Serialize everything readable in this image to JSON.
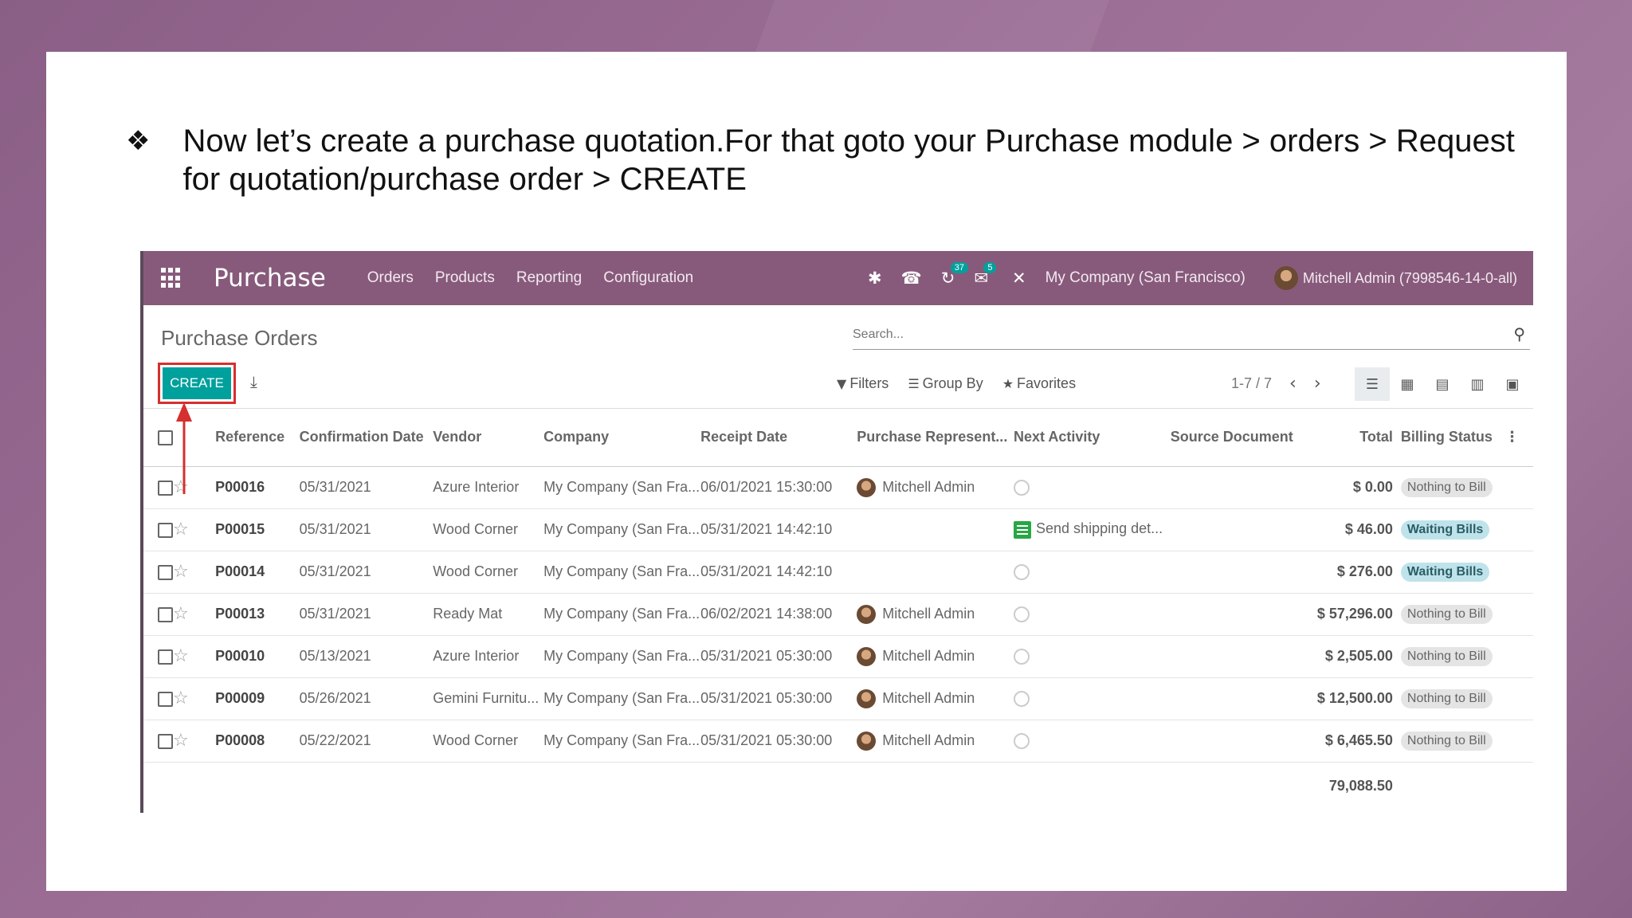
{
  "slide": {
    "bullet_glyph": "❖",
    "instruction": "Now let’s create a purchase quotation.For that goto your Purchase module > orders > Request for quotation/purchase order  > CREATE"
  },
  "navbar": {
    "app_name": "Purchase",
    "menu": [
      "Orders",
      "Products",
      "Reporting",
      "Configuration"
    ],
    "badge_activities": "37",
    "badge_messages": "5",
    "company": "My Company (San Francisco)",
    "user": "Mitchell Admin (7998546-14-0-all)"
  },
  "control_panel": {
    "breadcrumb": "Purchase Orders",
    "search_placeholder": "Search...",
    "create_label": "CREATE",
    "filters_label": "Filters",
    "group_by_label": "Group By",
    "favorites_label": "Favorites",
    "pager": "1-7 / 7"
  },
  "table": {
    "columns": [
      "Reference",
      "Confirmation Date",
      "Vendor",
      "Company",
      "Receipt Date",
      "Purchase Represent...",
      "Next Activity",
      "Source Document",
      "Total",
      "Billing Status"
    ],
    "rows": [
      {
        "ref": "P00016",
        "conf": "05/31/2021",
        "vendor": "Azure Interior",
        "company": "My Company (San Fra...",
        "receipt": "06/01/2021 15:30:00",
        "rep": "Mitchell Admin",
        "activity": "",
        "source": "",
        "total": "$ 0.00",
        "status": "Nothing to Bill"
      },
      {
        "ref": "P00015",
        "conf": "05/31/2021",
        "vendor": "Wood Corner",
        "company": "My Company (San Fra...",
        "receipt": "05/31/2021 14:42:10",
        "rep": "",
        "activity": "Send shipping det...",
        "source": "",
        "total": "$ 46.00",
        "status": "Waiting Bills"
      },
      {
        "ref": "P00014",
        "conf": "05/31/2021",
        "vendor": "Wood Corner",
        "company": "My Company (San Fra...",
        "receipt": "05/31/2021 14:42:10",
        "rep": "",
        "activity": "",
        "source": "",
        "total": "$ 276.00",
        "status": "Waiting Bills"
      },
      {
        "ref": "P00013",
        "conf": "05/31/2021",
        "vendor": "Ready Mat",
        "company": "My Company (San Fra...",
        "receipt": "06/02/2021 14:38:00",
        "rep": "Mitchell Admin",
        "activity": "",
        "source": "",
        "total": "$ 57,296.00",
        "status": "Nothing to Bill"
      },
      {
        "ref": "P00010",
        "conf": "05/13/2021",
        "vendor": "Azure Interior",
        "company": "My Company (San Fra...",
        "receipt": "05/31/2021 05:30:00",
        "rep": "Mitchell Admin",
        "activity": "",
        "source": "",
        "total": "$ 2,505.00",
        "status": "Nothing to Bill"
      },
      {
        "ref": "P00009",
        "conf": "05/26/2021",
        "vendor": "Gemini Furnitu...",
        "company": "My Company (San Fra...",
        "receipt": "05/31/2021 05:30:00",
        "rep": "Mitchell Admin",
        "activity": "",
        "source": "",
        "total": "$ 12,500.00",
        "status": "Nothing to Bill"
      },
      {
        "ref": "P00008",
        "conf": "05/22/2021",
        "vendor": "Wood Corner",
        "company": "My Company (San Fra...",
        "receipt": "05/31/2021 05:30:00",
        "rep": "Mitchell Admin",
        "activity": "",
        "source": "",
        "total": "$ 6,465.50",
        "status": "Nothing to Bill"
      }
    ],
    "grand_total": "79,088.50"
  },
  "colors": {
    "brand": "#875a7b",
    "accent": "#00a09d",
    "highlight": "#d62f2f"
  }
}
